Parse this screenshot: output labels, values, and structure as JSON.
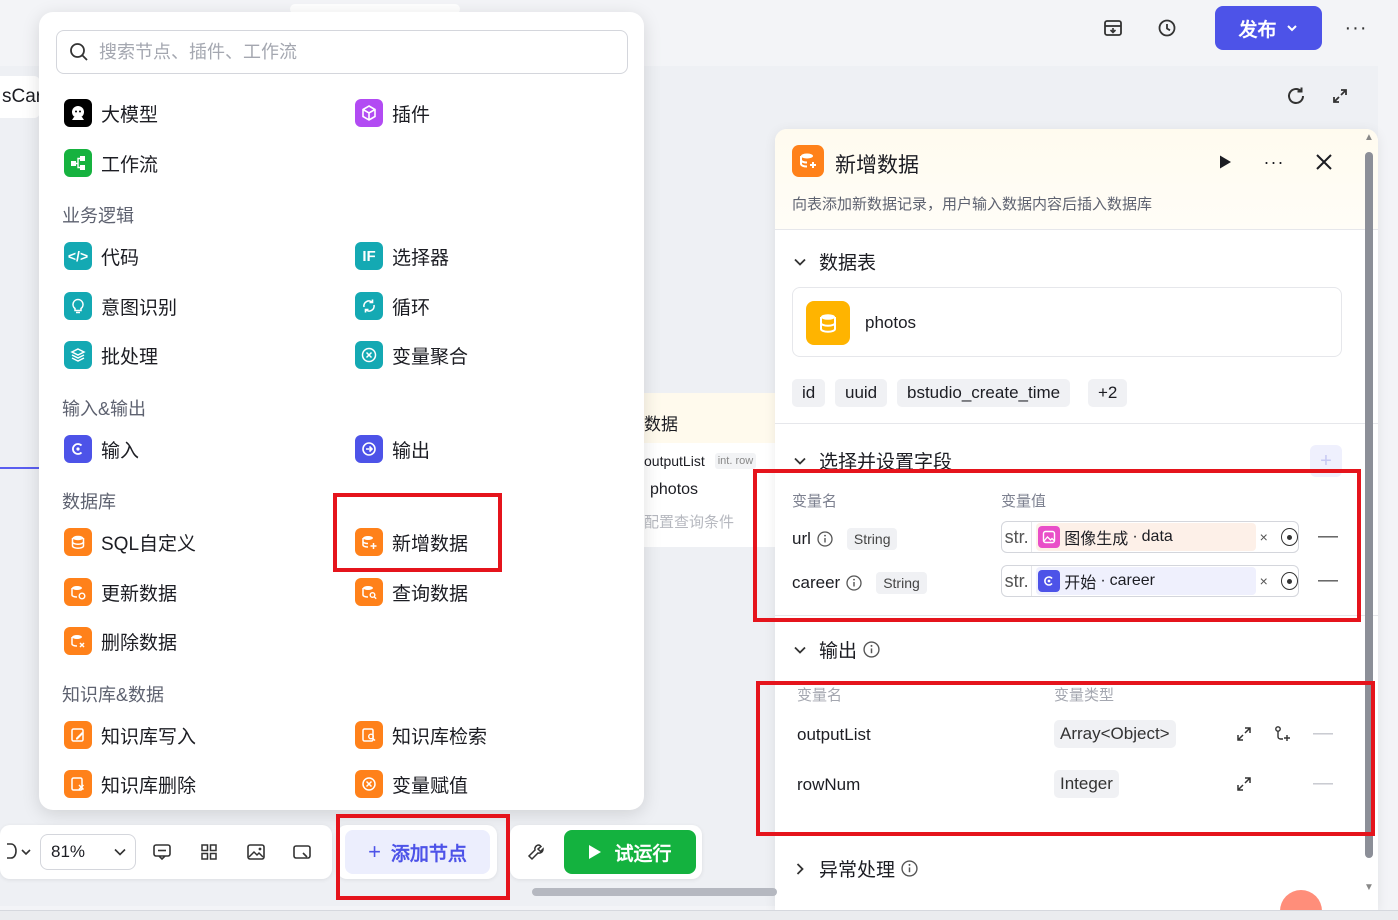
{
  "topbar": {
    "publish_label": "发布",
    "icons": [
      "download-box-icon",
      "history-icon",
      "more-icon"
    ]
  },
  "canvas": {
    "left_card_text": "sCar",
    "background_node": {
      "title": "数据",
      "output_field": "outputList",
      "output_tag": "int. row",
      "table_name": "photos",
      "placeholder": "配置查询条件"
    }
  },
  "menu": {
    "search_placeholder": "搜索节点、插件、工作流",
    "top_items": [
      {
        "label": "大模型",
        "icon": "llm-icon",
        "color": "#000000"
      },
      {
        "label": "插件",
        "icon": "plugin-cube-icon",
        "color": "#b24bf3"
      },
      {
        "label": "工作流",
        "icon": "workflow-icon",
        "color": "#16b23f"
      }
    ],
    "sections": [
      {
        "title": "业务逻辑",
        "items": [
          {
            "label": "代码",
            "icon": "code-icon",
            "color": "#14a9b3"
          },
          {
            "label": "选择器",
            "icon": "if-selector-icon",
            "color": "#14a9b3"
          },
          {
            "label": "意图识别",
            "icon": "intent-bulb-icon",
            "color": "#14a9b3"
          },
          {
            "label": "循环",
            "icon": "loop-icon",
            "color": "#14a9b3"
          },
          {
            "label": "批处理",
            "icon": "batch-layers-icon",
            "color": "#14a9b3"
          },
          {
            "label": "变量聚合",
            "icon": "variable-merge-icon",
            "color": "#14a9b3"
          }
        ]
      },
      {
        "title": "输入&输出",
        "items": [
          {
            "label": "输入",
            "icon": "input-icon",
            "color": "#4d53e8"
          },
          {
            "label": "输出",
            "icon": "output-icon",
            "color": "#4d53e8"
          }
        ]
      },
      {
        "title": "数据库",
        "items": [
          {
            "label": "SQL自定义",
            "icon": "sql-db-icon",
            "color": "#ff811a"
          },
          {
            "label": "新增数据",
            "icon": "db-add-icon",
            "color": "#ff811a"
          },
          {
            "label": "更新数据",
            "icon": "db-update-icon",
            "color": "#ff811a"
          },
          {
            "label": "查询数据",
            "icon": "db-query-icon",
            "color": "#ff811a"
          },
          {
            "label": "删除数据",
            "icon": "db-delete-icon",
            "color": "#ff811a"
          }
        ]
      },
      {
        "title": "知识库&数据",
        "items": [
          {
            "label": "知识库写入",
            "icon": "kb-write-icon",
            "color": "#ff811a"
          },
          {
            "label": "知识库检索",
            "icon": "kb-search-icon",
            "color": "#ff811a"
          },
          {
            "label": "知识库删除",
            "icon": "kb-delete-icon",
            "color": "#ff811a"
          },
          {
            "label": "变量赋值",
            "icon": "variable-assign-icon",
            "color": "#ff811a"
          }
        ]
      }
    ]
  },
  "toolbar": {
    "zoom": "81%",
    "add_node_label": "添加节点",
    "run_label": "试运行"
  },
  "panel": {
    "title": "新增数据",
    "description": "向表添加新数据记录，用户输入数据内容后插入数据库",
    "table_section": "数据表",
    "table_name": "photos",
    "fields": [
      "id",
      "uuid",
      "bstudio_create_time",
      "+2"
    ],
    "fields_section": "选择并设置字段",
    "col_var_name": "变量名",
    "col_var_value": "变量值",
    "inputs": [
      {
        "name": "url",
        "type": "String",
        "prefix": "str.",
        "source": "图像生成",
        "var": "data",
        "bg": "#fdf0e8",
        "source_color": "#e94ec8"
      },
      {
        "name": "career",
        "type": "String",
        "prefix": "str.",
        "source": "开始",
        "var": "career",
        "bg": "#eff0fd",
        "source_color": "#4d53e8"
      }
    ],
    "output_section": "输出",
    "col_out_name": "变量名",
    "col_out_type": "变量类型",
    "outputs": [
      {
        "name": "outputList",
        "type": "Array<Object>"
      },
      {
        "name": "rowNum",
        "type": "Integer"
      }
    ],
    "error_section": "异常处理"
  }
}
